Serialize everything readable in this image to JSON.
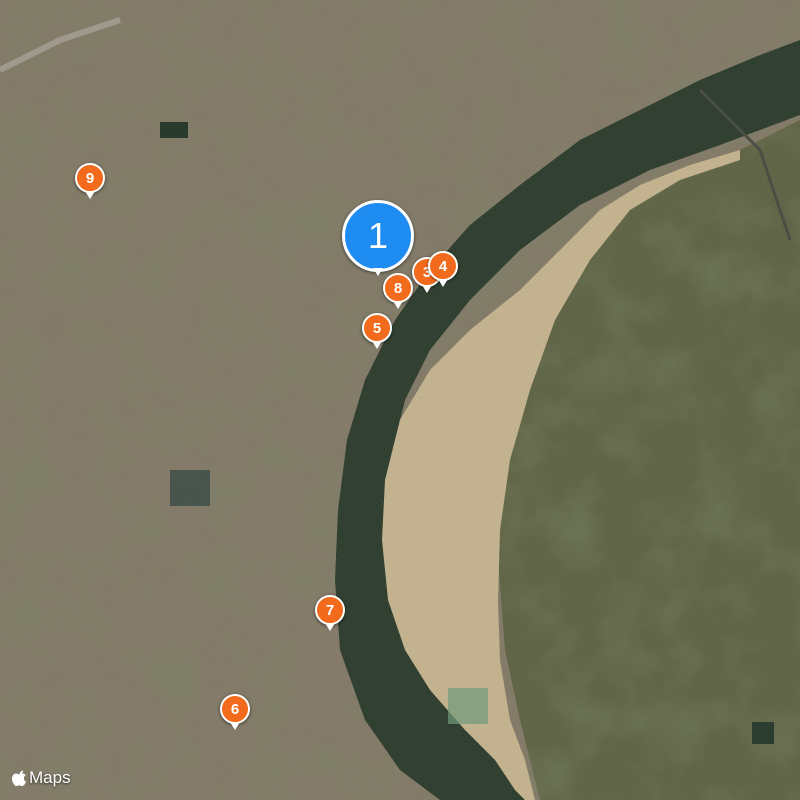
{
  "map": {
    "type": "satellite",
    "colors": {
      "water": "#223526",
      "sandbar": "#cdbb93",
      "urban": "#837a67",
      "vegetation": "#4c5a37",
      "marker": "#f26a1b",
      "selected_marker": "#1e8cf0"
    },
    "markers": [
      {
        "label": "1",
        "state": "selected"
      },
      {
        "label": "3",
        "state": "default"
      },
      {
        "label": "4",
        "state": "default"
      },
      {
        "label": "5",
        "state": "default"
      },
      {
        "label": "6",
        "state": "default"
      },
      {
        "label": "7",
        "state": "default"
      },
      {
        "label": "8",
        "state": "default"
      },
      {
        "label": "9",
        "state": "default"
      }
    ],
    "attribution": {
      "text": "Maps",
      "icon": "apple-logo-icon"
    }
  }
}
